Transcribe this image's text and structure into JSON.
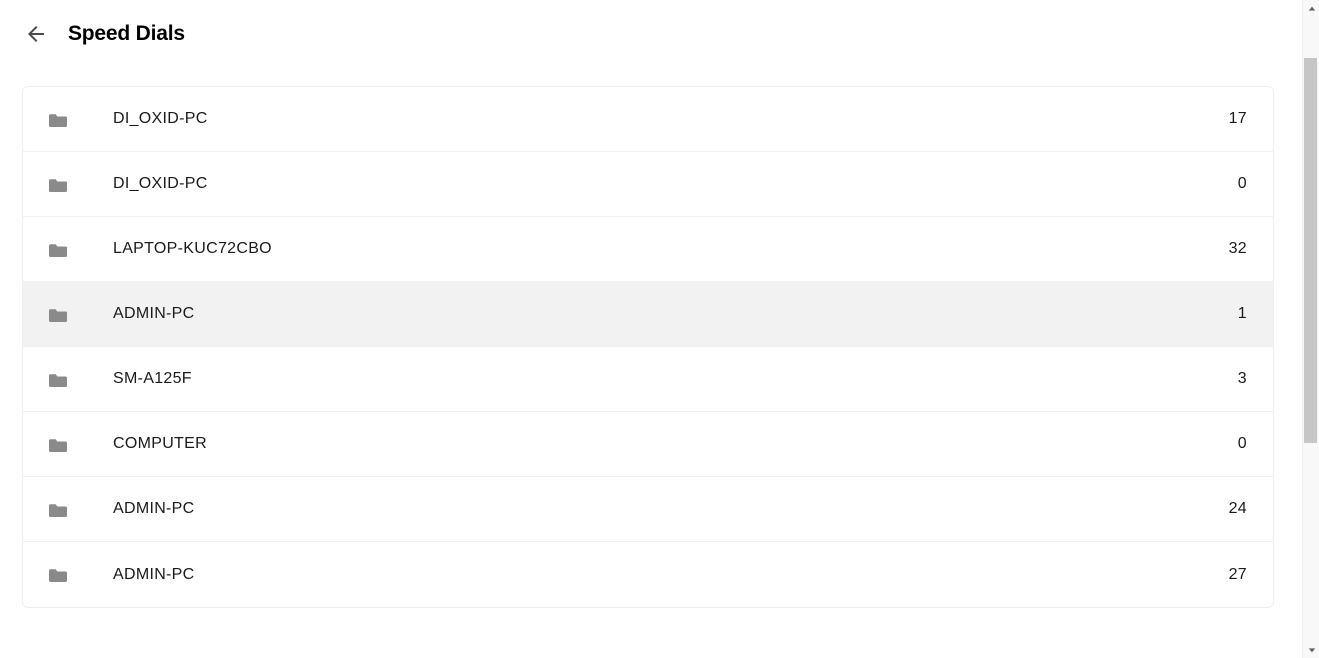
{
  "header": {
    "title": "Speed Dials"
  },
  "items": [
    {
      "label": "DI_OXID-PC",
      "count": "17",
      "highlighted": false
    },
    {
      "label": "DI_OXID-PC",
      "count": "0",
      "highlighted": false
    },
    {
      "label": "LAPTOP-KUC72CBO",
      "count": "32",
      "highlighted": false
    },
    {
      "label": "ADMIN-PC",
      "count": "1",
      "highlighted": true
    },
    {
      "label": "SM-A125F",
      "count": "3",
      "highlighted": false
    },
    {
      "label": "COMPUTER",
      "count": "0",
      "highlighted": false
    },
    {
      "label": "ADMIN-PC",
      "count": "24",
      "highlighted": false
    },
    {
      "label": "ADMIN-PC",
      "count": "27",
      "highlighted": false
    }
  ]
}
